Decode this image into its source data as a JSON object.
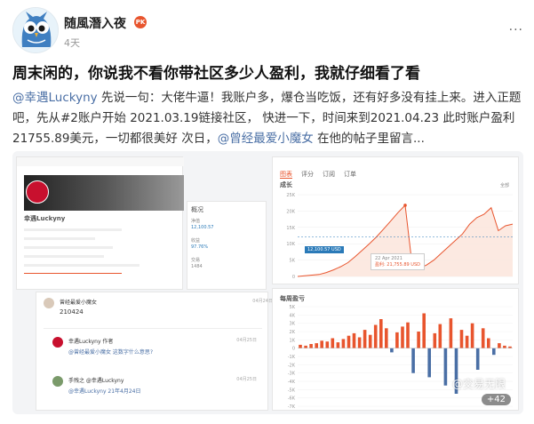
{
  "post": {
    "author": "随風潛入夜",
    "badge": "PK",
    "time": "4天",
    "more": "···",
    "title": "周末闲的，你说我不看你带社区多少人盈利，我就仔细看了看",
    "body_parts": [
      {
        "text": "@幸遇Luckyny",
        "mention": true
      },
      {
        "text": " 先说一句：大佬牛逼！我账户多，爆仓当吃饭，还有好多没有挂上来。进入正题吧，先从#2账户开始 2021.03.19链接社区， 快进一下，时间来到2021.04.23 此时账户盈利21755.89美元，一切都很美好 次日，",
        "mention": false
      },
      {
        "text": "@曾经最爱小魔女",
        "mention": true
      },
      {
        "text": " 在他的帖子里留言...",
        "mention": false
      }
    ]
  },
  "screenshot": {
    "profile": {
      "name": "幸遇Luckyny",
      "stats_label": "概况",
      "stats": [
        {
          "label": "净值",
          "value": "12,100.57"
        },
        {
          "label": "收益",
          "value": "97.76%"
        },
        {
          "label": "交易",
          "value": "1484"
        }
      ]
    },
    "chart_tabs": [
      "图表",
      "评分",
      "订阅",
      "订单"
    ],
    "growth": {
      "label": "成长",
      "range": "全部",
      "start_tag": "12,100.57 USD",
      "tooltip_date": "22 Apr 2021",
      "tooltip_value": "盈利: 21,755.89 USD"
    },
    "weekly": {
      "label": "每周盈亏"
    },
    "comments": [
      {
        "name": "曾经最爱小魔女",
        "time": "04月24日",
        "text": "210424"
      },
      {
        "name": "幸遇Luckyny 作者",
        "time": "04月25日",
        "text": "@曾经最爱小魔女 这数字什么意思?"
      },
      {
        "name": "手残之 @幸遇Luckyny",
        "time": "04月25日",
        "text": "@幸遇Luckyny 21年4月24日"
      }
    ],
    "watermark": "@交易无限",
    "image_count": "+42"
  },
  "chart_data": [
    {
      "type": "line",
      "title": "成长",
      "y_ticks": [
        "25K",
        "20K",
        "15K",
        "10K",
        "5K",
        "0"
      ],
      "ylim": [
        0,
        25000
      ],
      "x": [
        0,
        1,
        2,
        3,
        4,
        5,
        6,
        7,
        8,
        9,
        10,
        11,
        12,
        13,
        14,
        15,
        16,
        17,
        18,
        19,
        20,
        21,
        22,
        23,
        24,
        25,
        26,
        27,
        28,
        29,
        30
      ],
      "series": [
        {
          "values": [
            0,
            200,
            400,
            600,
            1200,
            2000,
            3000,
            4200,
            6000,
            8000,
            10000,
            12100,
            14500,
            17000,
            19500,
            21755,
            3000,
            2500,
            3500,
            5000,
            7000,
            9000,
            11000,
            13000,
            16000,
            18000,
            19000,
            21000,
            14000,
            15500,
            16000
          ]
        }
      ],
      "annotations": [
        "12,100.57 USD",
        "22 Apr 2021",
        "盈利: 21,755.89 USD"
      ]
    },
    {
      "type": "bar",
      "title": "每周盈亏",
      "y_ticks": [
        "5K",
        "4K",
        "3K",
        "2K",
        "1K",
        "0",
        "-1K",
        "-2K",
        "-3K",
        "-4K",
        "-5K",
        "-6K",
        "-7K"
      ],
      "ylim": [
        -7000,
        5000
      ],
      "categories": [
        1,
        2,
        3,
        4,
        5,
        6,
        7,
        8,
        9,
        10,
        11,
        12,
        13,
        14,
        15,
        16,
        17,
        18,
        19,
        20,
        21,
        22,
        23,
        24,
        25,
        26,
        27,
        28,
        29,
        30,
        31,
        32,
        33,
        34,
        35,
        36,
        37,
        38,
        39,
        40
      ],
      "values": [
        400,
        300,
        500,
        600,
        900,
        800,
        1200,
        700,
        1100,
        1500,
        1800,
        1300,
        2200,
        1600,
        2800,
        3500,
        2400,
        -500,
        1900,
        2600,
        3100,
        -3000,
        2000,
        4200,
        -3500,
        1800,
        2900,
        -4500,
        3600,
        -5500,
        2200,
        1500,
        3000,
        -2600,
        2400,
        1200,
        -800,
        600,
        300,
        200
      ]
    }
  ]
}
